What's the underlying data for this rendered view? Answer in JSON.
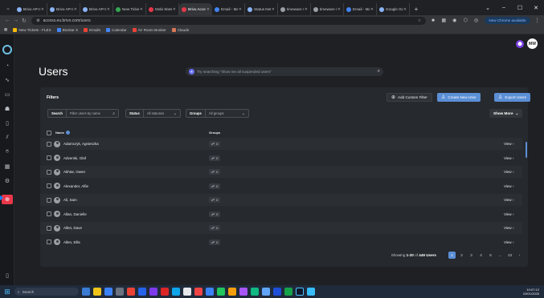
{
  "browser": {
    "tabs": [
      {
        "title": "Brivo API Do",
        "color": "#8ab4f8"
      },
      {
        "title": "Brivo API Do",
        "color": "#8ab4f8"
      },
      {
        "title": "Brivo API Do",
        "color": "#8ab4f8"
      },
      {
        "title": "New Ticket",
        "color": "#34a853"
      },
      {
        "title": "Mobi Sites",
        "color": "#e8374a"
      },
      {
        "title": "Brivo Access",
        "color": "#e8374a"
      },
      {
        "title": "Email - Mari",
        "color": "#4285f4"
      },
      {
        "title": "Status Net",
        "color": "#8ab4f8"
      },
      {
        "title": "timeware S",
        "color": "#9aa0a6"
      },
      {
        "title": "timeware S",
        "color": "#9aa0a6"
      },
      {
        "title": "Email - Mari",
        "color": "#4285f4"
      },
      {
        "title": "Google Gem",
        "color": "#8ab4f8"
      }
    ],
    "active_tab_index": 5,
    "url": "access.eu.brivo.com/users",
    "new_chrome_label": "New Chrome available",
    "bookmarks": [
      {
        "label": "New Tickets - FLEX",
        "color": "#fbbc04"
      },
      {
        "label": "BioStar X",
        "color": "#4285f4"
      },
      {
        "label": "Emails",
        "color": "#ea4335"
      },
      {
        "label": "Calendar",
        "color": "#4285f4"
      },
      {
        "label": "AV Room Booker",
        "color": "#ea4335"
      },
      {
        "label": "Claude",
        "color": "#d97757"
      }
    ]
  },
  "app": {
    "page_title": "Users",
    "ask_placeholder": "Try searching \"show me all suspended users\"",
    "user_initials": "MW",
    "filters_label": "Filters",
    "buttons": {
      "add_custom_filter": "Add Custom Filter",
      "create_new_user": "Create New User",
      "export_users": "Export Users",
      "show_more": "Show More"
    },
    "filters": {
      "search_label": "Search",
      "search_placeholder": "Filter users by name",
      "status_label": "Status",
      "status_value": "All statuses",
      "groups_label": "Groups",
      "groups_value": "All groups"
    },
    "columns": {
      "name": "Name",
      "groups": "Groups"
    },
    "users": [
      {
        "name": "Adamczyk, Agnieszka",
        "groups": "0",
        "action": "View"
      },
      {
        "name": "Adverski, Olaf",
        "groups": "0",
        "action": "View"
      },
      {
        "name": "Akhtar, Owen",
        "groups": "0",
        "action": "View"
      },
      {
        "name": "Alexander, Alfie",
        "groups": "0",
        "action": "View"
      },
      {
        "name": "Ali, Sam",
        "groups": "0",
        "action": "View"
      },
      {
        "name": "Allan, Danielle",
        "groups": "0",
        "action": "View"
      },
      {
        "name": "Allen, Dave",
        "groups": "0",
        "action": "View"
      },
      {
        "name": "Allen, Ellis",
        "groups": "0",
        "action": "View"
      }
    ],
    "pagination": {
      "showing_prefix": "Showing",
      "range": "1-20",
      "of": "of",
      "total": "449 Users",
      "pages": [
        "1",
        "2",
        "3",
        "4",
        "5",
        "...",
        "23"
      ],
      "current": "1",
      "next": "›"
    }
  },
  "taskbar": {
    "search_label": "Search",
    "time": "10:07:12",
    "date": "03/01/2026"
  }
}
